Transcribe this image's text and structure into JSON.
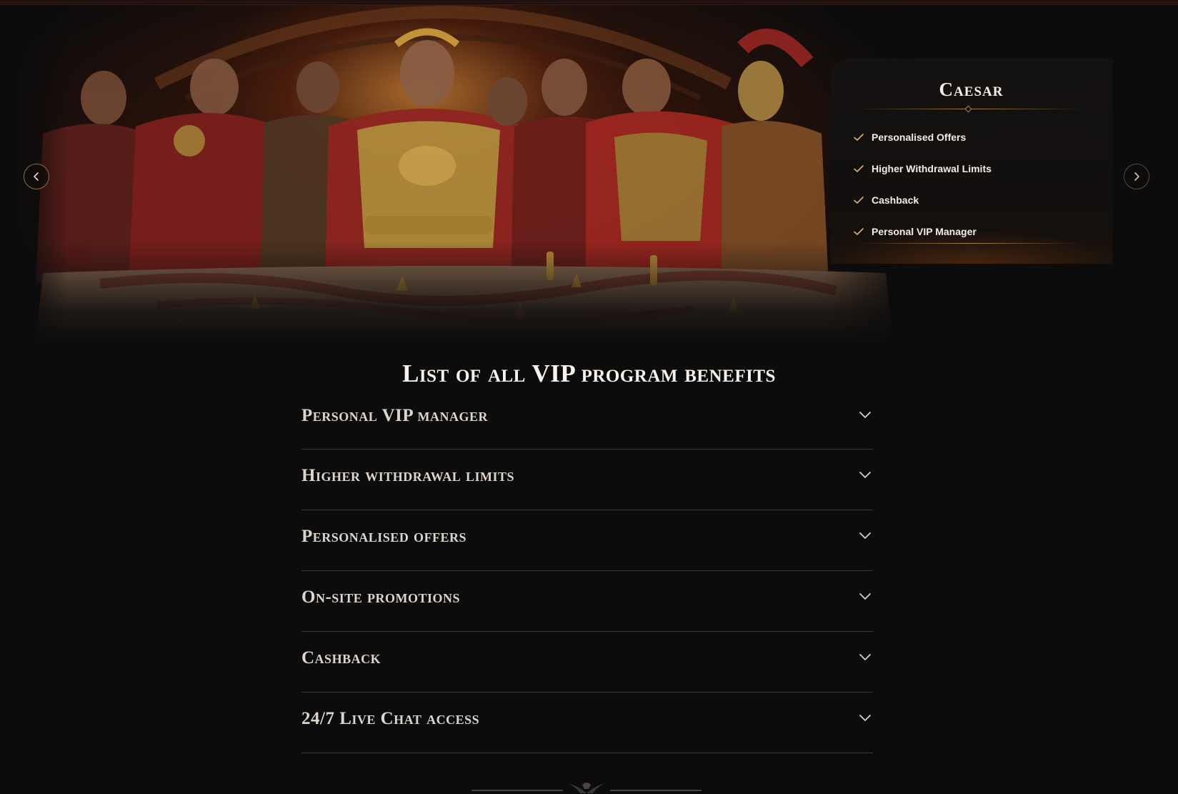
{
  "hero": {
    "prev_icon": "chevron-left-icon",
    "next_icon": "chevron-right-icon"
  },
  "tier_card": {
    "title": "Caesar",
    "check_icon": "check-icon",
    "accent_color": "#d9b56b",
    "benefits": [
      "Personalised Offers",
      "Higher Withdrawal Limits",
      "Cashback",
      "Personal VIP Manager"
    ]
  },
  "benefits_section": {
    "title": "List of all VIP program benefits",
    "chevron_icon": "chevron-down-icon",
    "items": [
      {
        "label": "Personal VIP manager"
      },
      {
        "label": "Higher withdrawal limits"
      },
      {
        "label": "Personalised offers"
      },
      {
        "label": "On-site promotions"
      },
      {
        "label": "Cashback"
      },
      {
        "label": "24/7 Live Chat access"
      }
    ]
  },
  "footer": {
    "ornament_icon": "eagle-emblem-icon"
  }
}
